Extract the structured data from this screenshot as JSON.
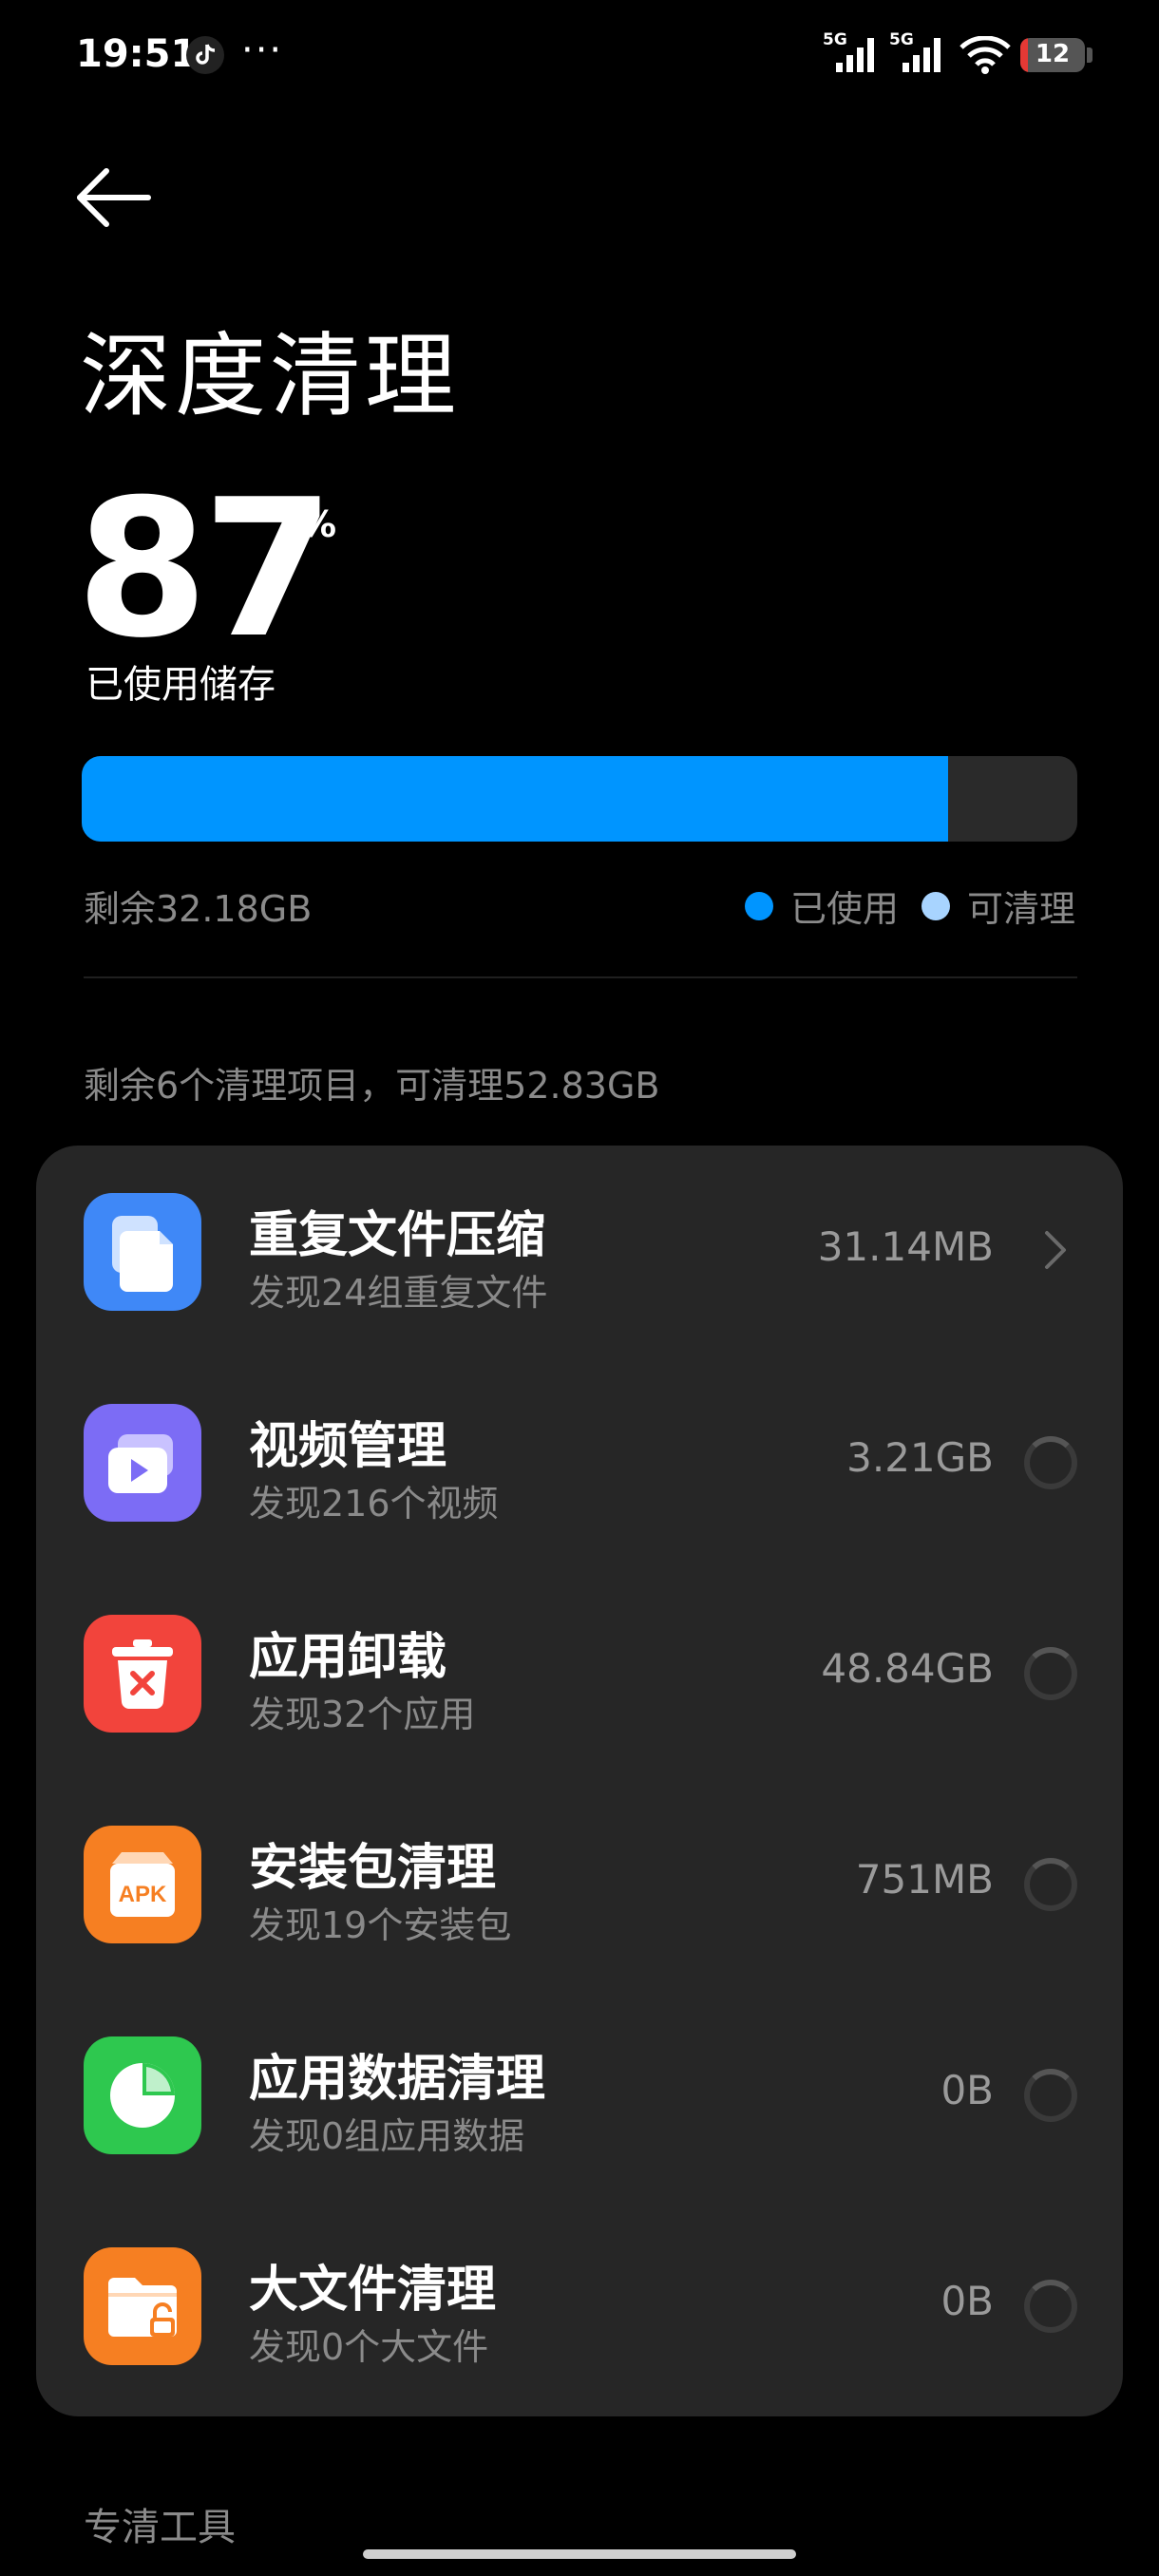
{
  "status_bar": {
    "time": "19:51",
    "more": "···",
    "signal1_tag": "5G",
    "signal2_tag": "5G",
    "battery": "12",
    "icons": [
      "tiktok-icon",
      "signal-icon",
      "signal-icon",
      "wifi-icon",
      "battery-icon"
    ]
  },
  "header": {
    "back_icon": "arrow-left-icon",
    "title": "深度清理"
  },
  "storage": {
    "percent": "87",
    "percent_sign": "%",
    "used_fraction": 0.87,
    "label": "已使用储存",
    "remaining": "剩余32.18GB",
    "legend_used": "已使用",
    "legend_cleanable": "可清理",
    "colors": {
      "used": "#0095ff",
      "cleanable": "#a8d4ff",
      "track": "#2a2a2a"
    }
  },
  "summary": "剩余6个清理项目，可清理52.83GB",
  "items": [
    {
      "title": "重复文件压缩",
      "subtitle": "发现24组重复文件",
      "size": "31.14MB",
      "icon": "duplicate-files-icon",
      "color": "#3f88f7",
      "state": "done"
    },
    {
      "title": "视频管理",
      "subtitle": "发现216个视频",
      "size": "3.21GB",
      "icon": "video-icon",
      "color": "#7c6cf5",
      "state": "loading"
    },
    {
      "title": "应用卸载",
      "subtitle": "发现32个应用",
      "size": "48.84GB",
      "icon": "trash-icon",
      "color": "#f2443c",
      "state": "loading"
    },
    {
      "title": "安装包清理",
      "subtitle": "发现19个安装包",
      "size": "751MB",
      "icon": "apk-icon",
      "apk_text": "APK",
      "color": "#f67f22",
      "state": "loading"
    },
    {
      "title": "应用数据清理",
      "subtitle": "发现0组应用数据",
      "size": "0B",
      "icon": "pie-chart-icon",
      "color": "#2ec84f",
      "state": "loading"
    },
    {
      "title": "大文件清理",
      "subtitle": "发现0个大文件",
      "size": "0B",
      "icon": "folder-lock-icon",
      "color": "#f67f22",
      "state": "loading"
    }
  ],
  "section_label": "专清工具"
}
